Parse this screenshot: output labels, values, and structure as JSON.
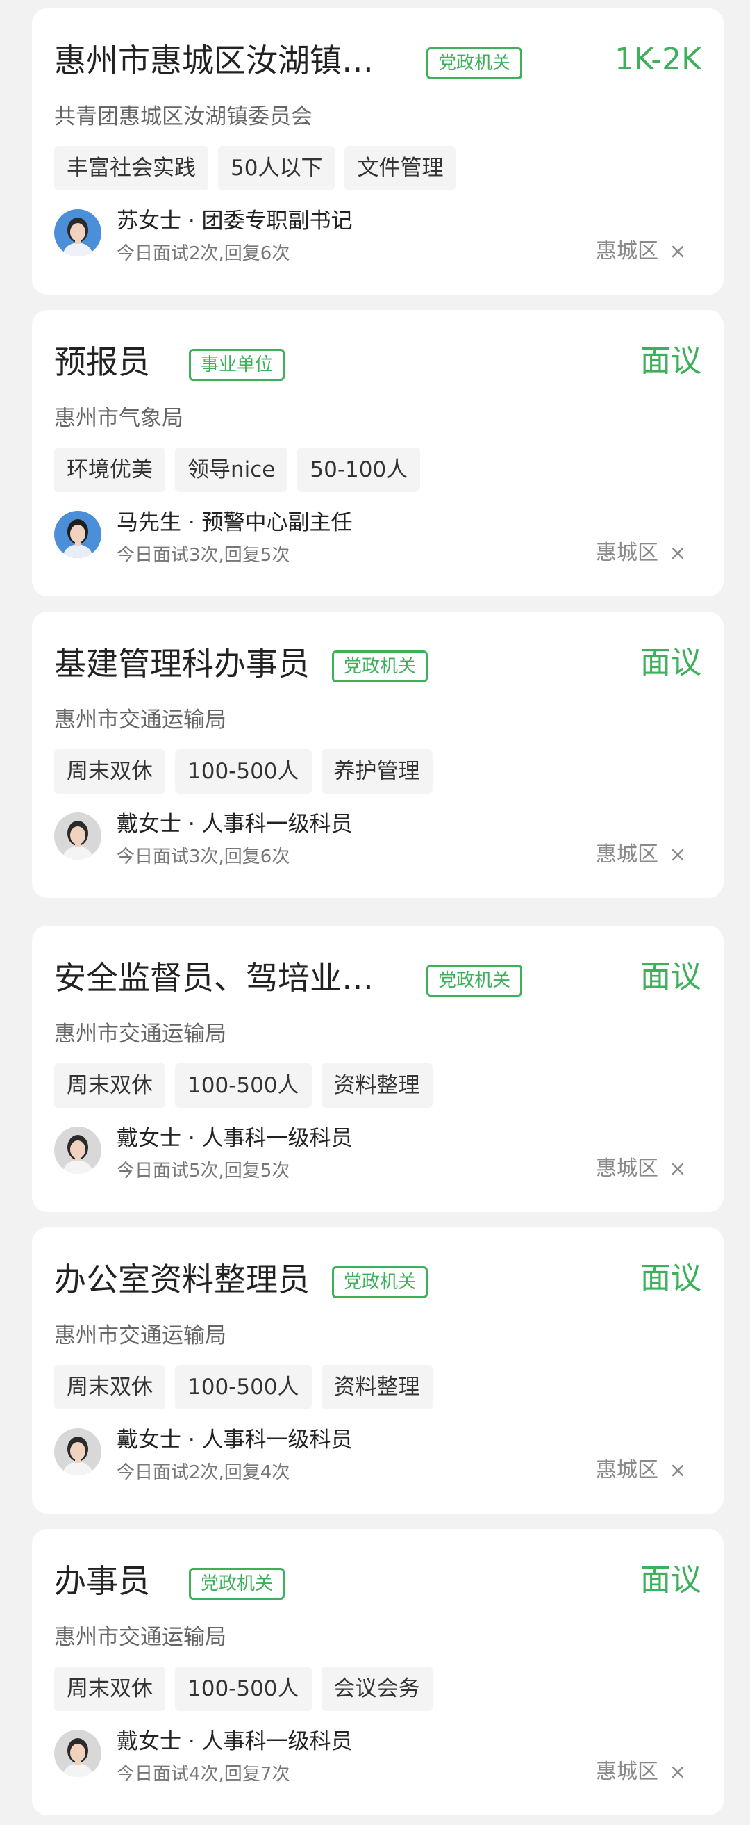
{
  "jobs": [
    {
      "title": "惠州市惠城区汝湖镇…",
      "unit_type": "党政机关",
      "salary": "1K-2K",
      "company": "共青团惠城区汝湖镇委员会",
      "tags": [
        "丰富社会实践",
        "50人以下",
        "文件管理"
      ],
      "recruiter": "苏女士 · 团委专职副书记",
      "activity": "今日面试2次,回复6次",
      "district": "惠城区",
      "avatar_style": "blue"
    },
    {
      "title": "预报员",
      "unit_type": "事业单位",
      "salary": "面议",
      "company": "惠州市气象局",
      "tags": [
        "环境优美",
        "领导nice",
        "50-100人"
      ],
      "recruiter": "马先生 · 预警中心副主任",
      "activity": "今日面试3次,回复5次",
      "district": "惠城区",
      "avatar_style": "blue-male"
    },
    {
      "title": "基建管理科办事员",
      "unit_type": "党政机关",
      "salary": "面议",
      "company": "惠州市交通运输局",
      "tags": [
        "周末双休",
        "100-500人",
        "养护管理"
      ],
      "recruiter": "戴女士 · 人事科一级科员",
      "activity": "今日面试3次,回复6次",
      "district": "惠城区",
      "avatar_style": "grey"
    },
    {
      "title": "安全监督员、驾培业…",
      "unit_type": "党政机关",
      "salary": "面议",
      "company": "惠州市交通运输局",
      "tags": [
        "周末双休",
        "100-500人",
        "资料整理"
      ],
      "recruiter": "戴女士 · 人事科一级科员",
      "activity": "今日面试5次,回复5次",
      "district": "惠城区",
      "avatar_style": "grey"
    },
    {
      "title": "办公室资料整理员",
      "unit_type": "党政机关",
      "salary": "面议",
      "company": "惠州市交通运输局",
      "tags": [
        "周末双休",
        "100-500人",
        "资料整理"
      ],
      "recruiter": "戴女士 · 人事科一级科员",
      "activity": "今日面试2次,回复4次",
      "district": "惠城区",
      "avatar_style": "grey"
    },
    {
      "title": "办事员",
      "unit_type": "党政机关",
      "salary": "面议",
      "company": "惠州市交通运输局",
      "tags": [
        "周末双休",
        "100-500人",
        "会议会务"
      ],
      "recruiter": "戴女士 · 人事科一级科员",
      "activity": "今日面试4次,回复7次",
      "district": "惠城区",
      "avatar_style": "grey"
    }
  ],
  "icons": {
    "avatar": "person-photo-icon",
    "close": "close-icon"
  },
  "colors": {
    "accent_green": "#3cb05a",
    "card_bg": "#ffffff",
    "page_bg": "#f2f2f2",
    "tag_bg": "#f4f4f4"
  }
}
